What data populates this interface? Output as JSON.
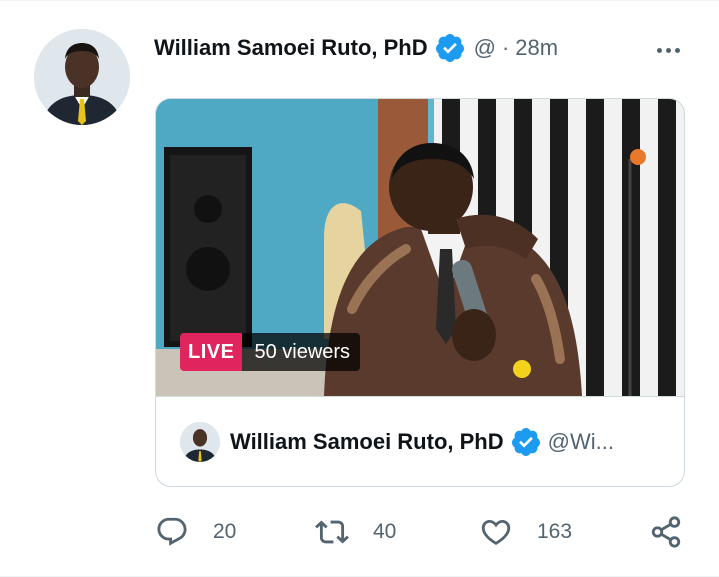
{
  "tweet": {
    "author_name": "William Samoei Ruto, PhD",
    "handle": "@",
    "separator": "·",
    "time": "28m",
    "avatar_icon": "profile-photo",
    "verified_icon": "verified-badge-icon",
    "more_icon": "more-options-icon"
  },
  "card": {
    "live_label": "LIVE",
    "viewers_label": "50 viewers",
    "broadcaster_name": "William Samoei Ruto, PhD",
    "broadcaster_handle": "@Wi..."
  },
  "actions": {
    "reply_count": "20",
    "retweet_count": "40",
    "like_count": "163",
    "reply_icon": "reply-icon",
    "retweet_icon": "retweet-icon",
    "like_icon": "heart-icon",
    "share_icon": "share-icon"
  },
  "colors": {
    "verified": "#1d9bf0",
    "live": "#e0245e",
    "secondary_text": "#536471",
    "border": "#cfd9de"
  }
}
